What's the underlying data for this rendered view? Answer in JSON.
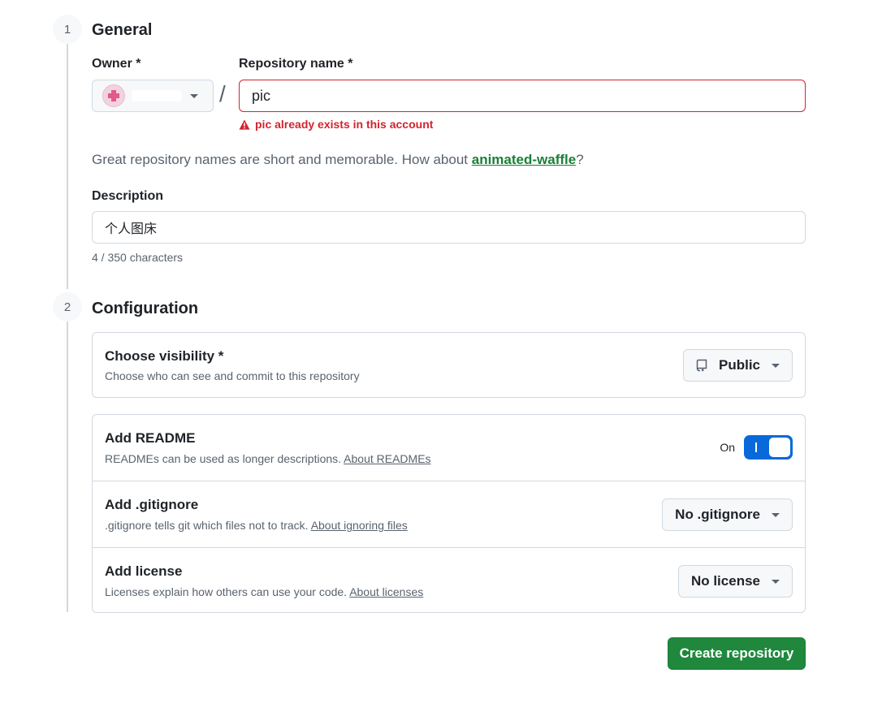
{
  "general": {
    "step_number": "1",
    "title": "General",
    "owner_label": "Owner *",
    "repo_name_label": "Repository name *",
    "separator": "/",
    "repo_name_value": "pic",
    "error_message": "pic already exists in this account",
    "suggestion_prefix": "Great repository names are short and memorable. How about ",
    "suggestion_name": "animated-waffle",
    "suggestion_suffix": "?",
    "description_label": "Description",
    "description_value": "个人图床",
    "char_count": "4 / 350 characters"
  },
  "configuration": {
    "step_number": "2",
    "title": "Configuration",
    "visibility": {
      "title": "Choose visibility *",
      "subtitle": "Choose who can see and commit to this repository",
      "selected": "Public"
    },
    "readme": {
      "title": "Add README",
      "subtitle": "READMEs can be used as longer descriptions. ",
      "link": "About READMEs",
      "toggle_label": "On"
    },
    "gitignore": {
      "title": "Add .gitignore",
      "subtitle": ".gitignore tells git which files not to track. ",
      "link": "About ignoring files",
      "selected": "No .gitignore"
    },
    "license": {
      "title": "Add license",
      "subtitle": "Licenses explain how others can use your code. ",
      "link": "About licenses",
      "selected": "No license"
    }
  },
  "actions": {
    "create_label": "Create repository"
  },
  "colors": {
    "error": "#d1242f",
    "accent_green": "#1f883d",
    "toggle_blue": "#0969da"
  }
}
